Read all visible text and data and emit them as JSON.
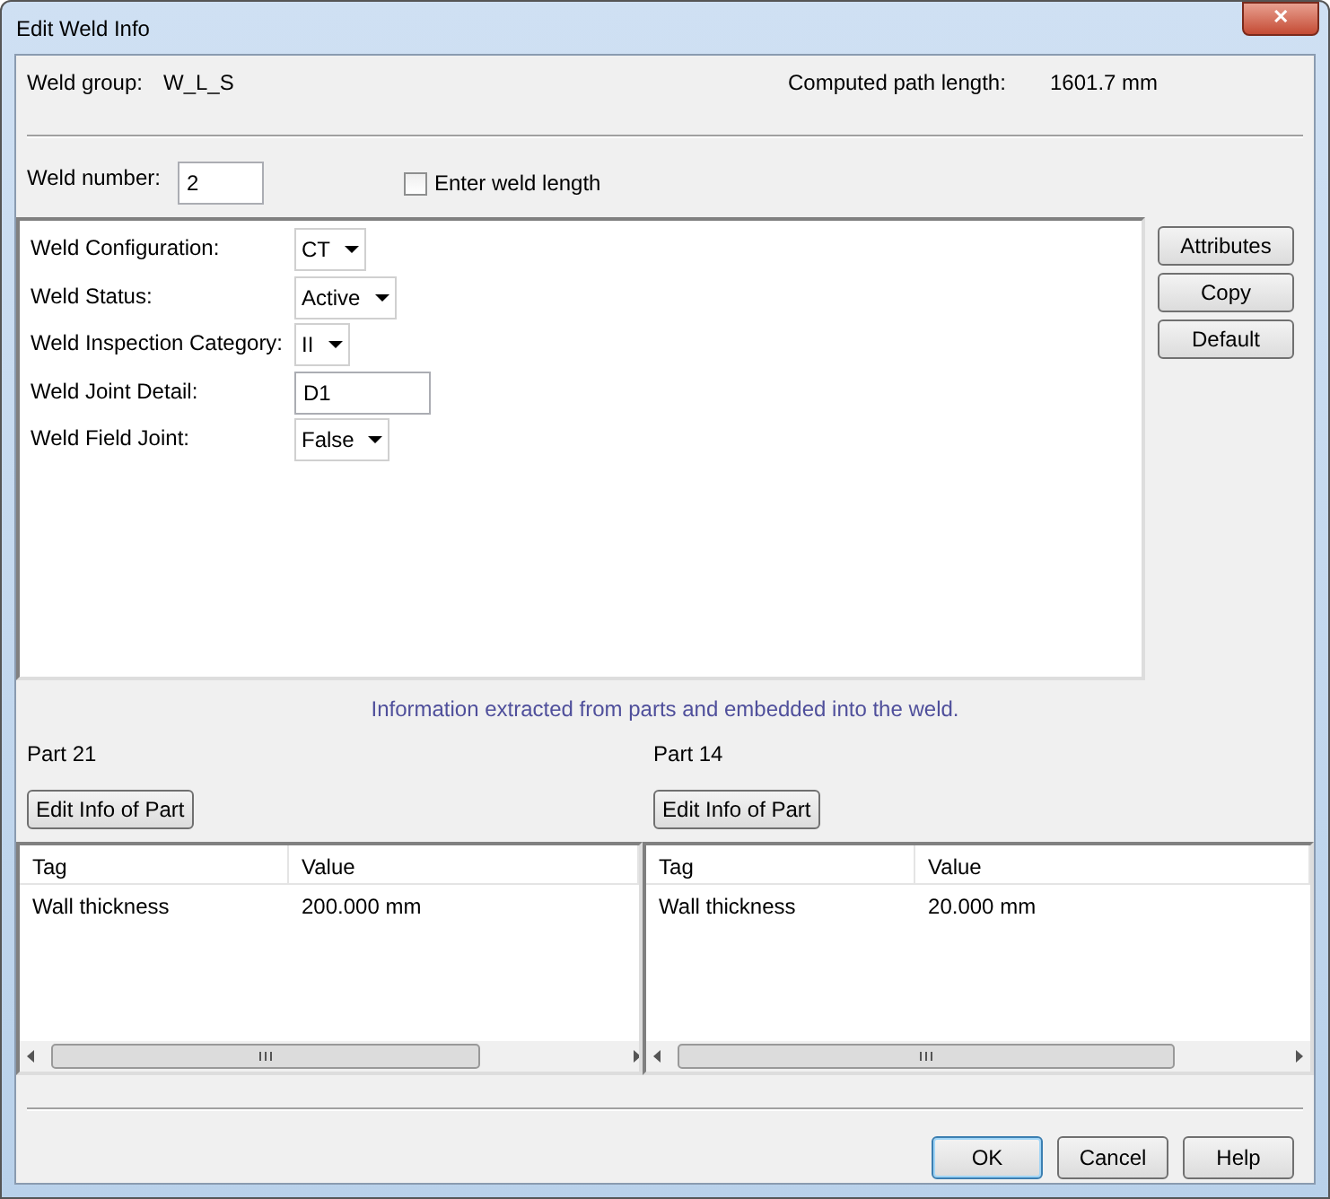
{
  "window": {
    "title": "Edit Weld Info",
    "close_label": "✕"
  },
  "weld_group": {
    "label": "Weld group:",
    "value": "W_L_S"
  },
  "path_length": {
    "label": "Computed path length:",
    "value": "1601.7 mm"
  },
  "weld_number": {
    "label": "Weld number:",
    "value": "2"
  },
  "enter_weld_length": {
    "label": "Enter weld length",
    "checked": false
  },
  "attributes": [
    {
      "label": "Weld Configuration:",
      "kind": "dropdown",
      "value": "CT"
    },
    {
      "label": "Weld Status:",
      "kind": "dropdown",
      "value": "Active"
    },
    {
      "label": "Weld Inspection Category:",
      "kind": "dropdown",
      "value": "II"
    },
    {
      "label": "Weld Joint Detail:",
      "kind": "text",
      "value": "D1"
    },
    {
      "label": "Weld Field Joint:",
      "kind": "dropdown",
      "value": "False"
    }
  ],
  "side_buttons": [
    "Attributes",
    "Copy",
    "Default"
  ],
  "info_text": "Information extracted from parts and embedded into the weld.",
  "parts": [
    {
      "title": "Part 21",
      "button": "Edit Info of Part",
      "columns": [
        "Tag",
        "Value"
      ],
      "rows": [
        [
          "Wall thickness",
          "200.000 mm"
        ]
      ]
    },
    {
      "title": "Part 14",
      "button": "Edit Info of Part",
      "columns": [
        "Tag",
        "Value"
      ],
      "rows": [
        [
          "Wall thickness",
          "20.000 mm"
        ]
      ]
    }
  ],
  "buttons": [
    {
      "label": "OK",
      "default": true
    },
    {
      "label": "Cancel",
      "default": false
    },
    {
      "label": "Help",
      "default": false
    }
  ]
}
